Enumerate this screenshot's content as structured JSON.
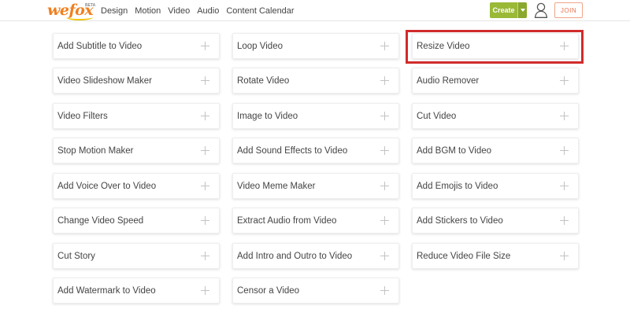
{
  "header": {
    "logo": "wefox",
    "logo_tag": "BETA",
    "nav": [
      "Design",
      "Motion",
      "Video",
      "Audio",
      "Content Calendar"
    ],
    "create_label": "Create",
    "join_label": "JOIN",
    "icons": {
      "user": "user-icon",
      "caret": "chevron-down-icon"
    }
  },
  "tools": {
    "column_1": [
      "Add Subtitle to Video",
      "Video Slideshow Maker",
      "Video Filters",
      "Stop Motion Maker",
      "Add Voice Over to Video",
      "Change Video Speed",
      "Cut Story",
      "Add Watermark to Video"
    ],
    "column_2": [
      "Loop Video",
      "Rotate Video",
      "Image to Video",
      "Add Sound Effects to Video",
      "Video Meme Maker",
      "Extract Audio from Video",
      "Add Intro and Outro to Video",
      "Censor a Video"
    ],
    "column_3": [
      "Resize Video",
      "Audio Remover",
      "Cut Video",
      "Add BGM to Video",
      "Add Emojis to Video",
      "Add Stickers to Video",
      "Reduce Video File Size"
    ]
  },
  "highlighted_tool": "Resize Video",
  "colors": {
    "logo": "#f07f1e",
    "create": "#9ab936",
    "join": "#e8734e",
    "highlight": "#d12b2b"
  }
}
